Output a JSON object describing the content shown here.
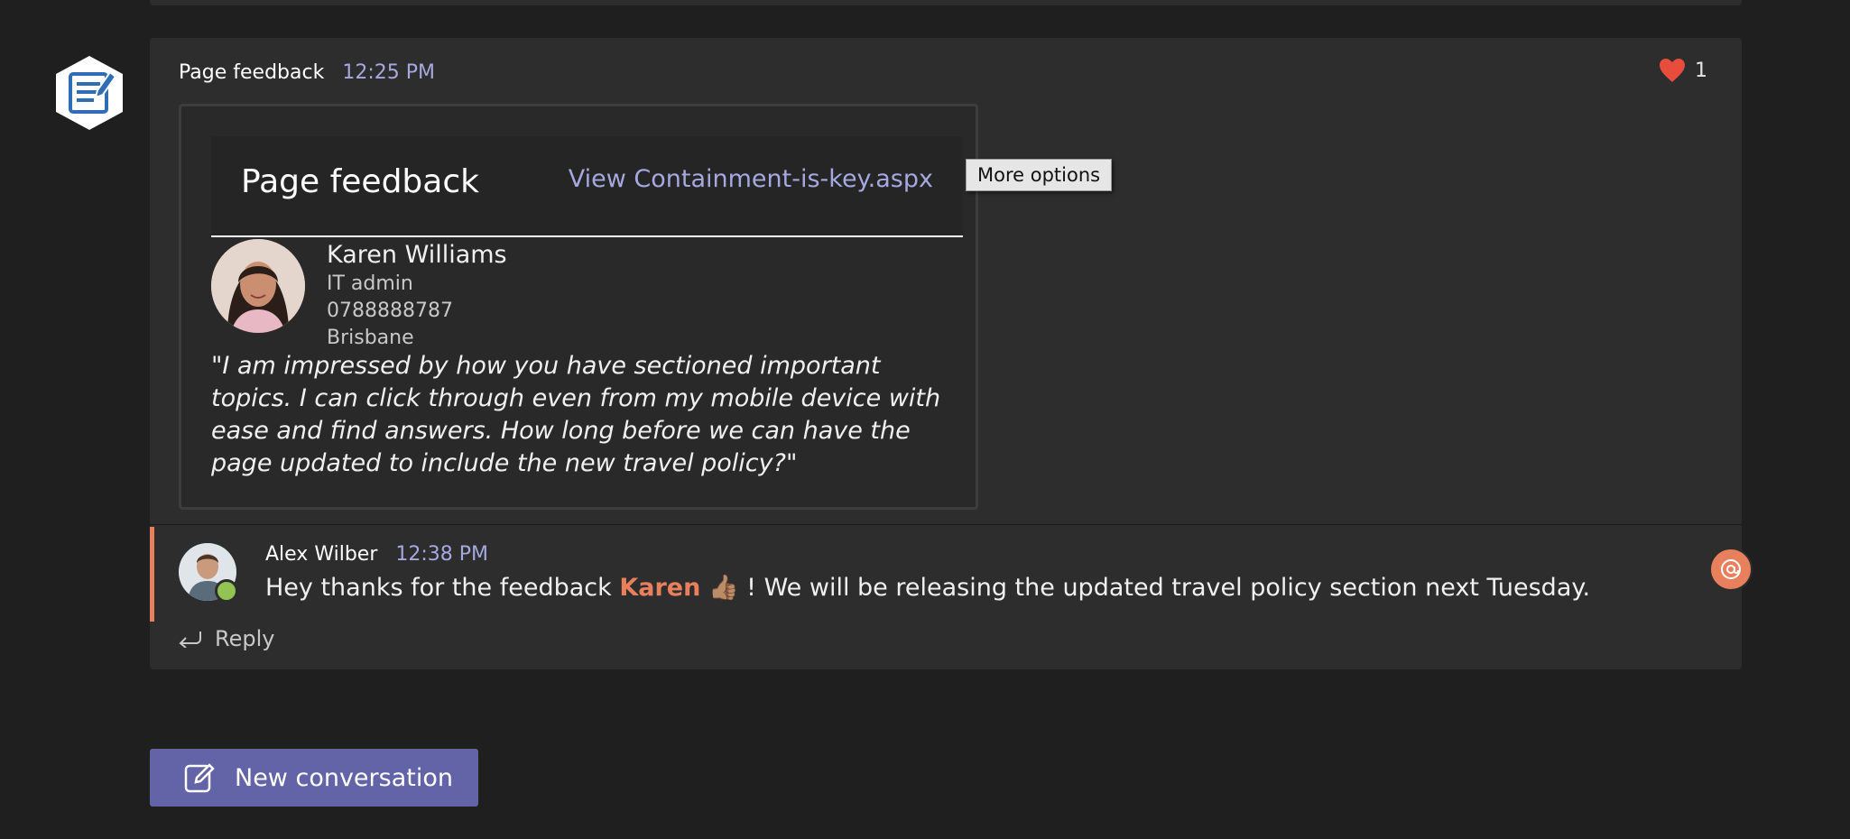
{
  "message": {
    "sender": "Page feedback",
    "time": "12:25 PM",
    "reaction": {
      "icon": "heart-icon",
      "count": "1"
    }
  },
  "card": {
    "title": "Page feedback",
    "link": "View Containment-is-key.aspx",
    "person": {
      "name": "Karen Williams",
      "role": "IT admin",
      "phone": "0788888787",
      "location": "Brisbane"
    },
    "quote": "I am impressed by how you have sectioned important topics. I can click through even from my mobile device with ease and find answers. How long before we can have the page updated to include the new travel policy?"
  },
  "tooltip": "More options",
  "reply": {
    "sender": "Alex Wilber",
    "time": "12:38 PM",
    "text_before": "Hey thanks for the feedback",
    "mention": "Karen",
    "emoji": "👍🏽",
    "text_after": "! We will be releasing the updated travel policy section next Tuesday.",
    "action_label": "Reply"
  },
  "new_conversation": {
    "label": "New conversation"
  },
  "colors": {
    "accent": "#6264a7",
    "mention": "#e9805d",
    "link": "#a7a8e0",
    "presence": "#92c353"
  }
}
